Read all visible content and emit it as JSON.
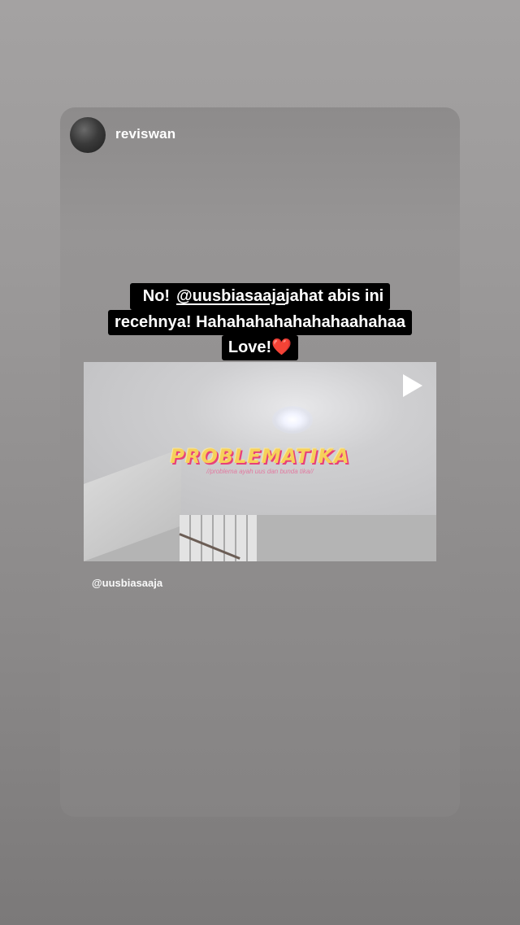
{
  "story": {
    "username": "reviswan",
    "caption_lines": [
      {
        "before": "No! ",
        "mention": "@uusbiasaaja",
        "after": " jahat abis ini"
      },
      {
        "text": "recehnya! Hahahahahahahahaahahaa"
      },
      {
        "text": "Love! ",
        "emoji": "❤️"
      }
    ],
    "shared_post": {
      "logo_title": "PROBLEMATIKA",
      "logo_subtitle": "//problema ayah uus dan bunda tika//",
      "credit": "@uusbiasaaja"
    }
  }
}
